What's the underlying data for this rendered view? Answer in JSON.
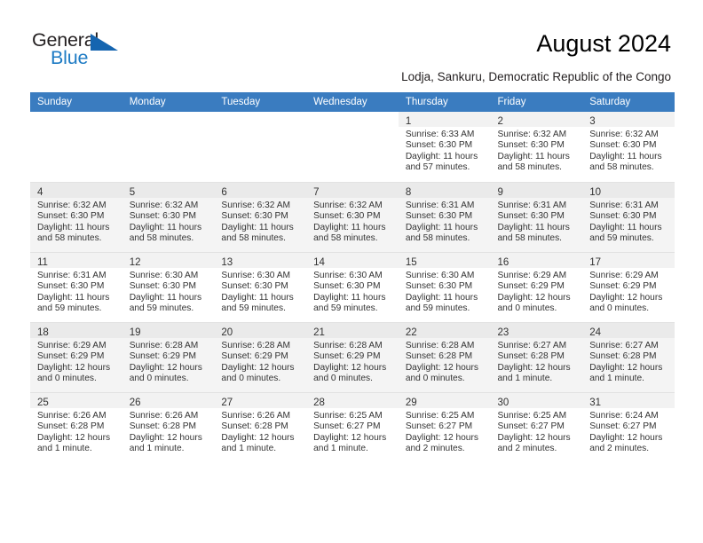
{
  "brand": {
    "name_part1": "General",
    "name_part2": "Blue",
    "triangle_color": "#1565b0",
    "blue_color": "#1e7bc4"
  },
  "header": {
    "title": "August 2024",
    "location": "Lodja, Sankuru, Democratic Republic of the Congo",
    "header_bg": "#3a7cc0"
  },
  "weekdays": [
    "Sunday",
    "Monday",
    "Tuesday",
    "Wednesday",
    "Thursday",
    "Friday",
    "Saturday"
  ],
  "weeks": [
    {
      "shaded": false,
      "days": [
        {
          "empty": true
        },
        {
          "empty": true
        },
        {
          "empty": true
        },
        {
          "empty": true
        },
        {
          "day": "1",
          "sunrise": "Sunrise: 6:33 AM",
          "sunset": "Sunset: 6:30 PM",
          "daylight1": "Daylight: 11 hours",
          "daylight2": "and 57 minutes."
        },
        {
          "day": "2",
          "sunrise": "Sunrise: 6:32 AM",
          "sunset": "Sunset: 6:30 PM",
          "daylight1": "Daylight: 11 hours",
          "daylight2": "and 58 minutes."
        },
        {
          "day": "3",
          "sunrise": "Sunrise: 6:32 AM",
          "sunset": "Sunset: 6:30 PM",
          "daylight1": "Daylight: 11 hours",
          "daylight2": "and 58 minutes."
        }
      ]
    },
    {
      "shaded": true,
      "days": [
        {
          "day": "4",
          "sunrise": "Sunrise: 6:32 AM",
          "sunset": "Sunset: 6:30 PM",
          "daylight1": "Daylight: 11 hours",
          "daylight2": "and 58 minutes."
        },
        {
          "day": "5",
          "sunrise": "Sunrise: 6:32 AM",
          "sunset": "Sunset: 6:30 PM",
          "daylight1": "Daylight: 11 hours",
          "daylight2": "and 58 minutes."
        },
        {
          "day": "6",
          "sunrise": "Sunrise: 6:32 AM",
          "sunset": "Sunset: 6:30 PM",
          "daylight1": "Daylight: 11 hours",
          "daylight2": "and 58 minutes."
        },
        {
          "day": "7",
          "sunrise": "Sunrise: 6:32 AM",
          "sunset": "Sunset: 6:30 PM",
          "daylight1": "Daylight: 11 hours",
          "daylight2": "and 58 minutes."
        },
        {
          "day": "8",
          "sunrise": "Sunrise: 6:31 AM",
          "sunset": "Sunset: 6:30 PM",
          "daylight1": "Daylight: 11 hours",
          "daylight2": "and 58 minutes."
        },
        {
          "day": "9",
          "sunrise": "Sunrise: 6:31 AM",
          "sunset": "Sunset: 6:30 PM",
          "daylight1": "Daylight: 11 hours",
          "daylight2": "and 58 minutes."
        },
        {
          "day": "10",
          "sunrise": "Sunrise: 6:31 AM",
          "sunset": "Sunset: 6:30 PM",
          "daylight1": "Daylight: 11 hours",
          "daylight2": "and 59 minutes."
        }
      ]
    },
    {
      "shaded": false,
      "days": [
        {
          "day": "11",
          "sunrise": "Sunrise: 6:31 AM",
          "sunset": "Sunset: 6:30 PM",
          "daylight1": "Daylight: 11 hours",
          "daylight2": "and 59 minutes."
        },
        {
          "day": "12",
          "sunrise": "Sunrise: 6:30 AM",
          "sunset": "Sunset: 6:30 PM",
          "daylight1": "Daylight: 11 hours",
          "daylight2": "and 59 minutes."
        },
        {
          "day": "13",
          "sunrise": "Sunrise: 6:30 AM",
          "sunset": "Sunset: 6:30 PM",
          "daylight1": "Daylight: 11 hours",
          "daylight2": "and 59 minutes."
        },
        {
          "day": "14",
          "sunrise": "Sunrise: 6:30 AM",
          "sunset": "Sunset: 6:30 PM",
          "daylight1": "Daylight: 11 hours",
          "daylight2": "and 59 minutes."
        },
        {
          "day": "15",
          "sunrise": "Sunrise: 6:30 AM",
          "sunset": "Sunset: 6:30 PM",
          "daylight1": "Daylight: 11 hours",
          "daylight2": "and 59 minutes."
        },
        {
          "day": "16",
          "sunrise": "Sunrise: 6:29 AM",
          "sunset": "Sunset: 6:29 PM",
          "daylight1": "Daylight: 12 hours",
          "daylight2": "and 0 minutes."
        },
        {
          "day": "17",
          "sunrise": "Sunrise: 6:29 AM",
          "sunset": "Sunset: 6:29 PM",
          "daylight1": "Daylight: 12 hours",
          "daylight2": "and 0 minutes."
        }
      ]
    },
    {
      "shaded": true,
      "days": [
        {
          "day": "18",
          "sunrise": "Sunrise: 6:29 AM",
          "sunset": "Sunset: 6:29 PM",
          "daylight1": "Daylight: 12 hours",
          "daylight2": "and 0 minutes."
        },
        {
          "day": "19",
          "sunrise": "Sunrise: 6:28 AM",
          "sunset": "Sunset: 6:29 PM",
          "daylight1": "Daylight: 12 hours",
          "daylight2": "and 0 minutes."
        },
        {
          "day": "20",
          "sunrise": "Sunrise: 6:28 AM",
          "sunset": "Sunset: 6:29 PM",
          "daylight1": "Daylight: 12 hours",
          "daylight2": "and 0 minutes."
        },
        {
          "day": "21",
          "sunrise": "Sunrise: 6:28 AM",
          "sunset": "Sunset: 6:29 PM",
          "daylight1": "Daylight: 12 hours",
          "daylight2": "and 0 minutes."
        },
        {
          "day": "22",
          "sunrise": "Sunrise: 6:28 AM",
          "sunset": "Sunset: 6:28 PM",
          "daylight1": "Daylight: 12 hours",
          "daylight2": "and 0 minutes."
        },
        {
          "day": "23",
          "sunrise": "Sunrise: 6:27 AM",
          "sunset": "Sunset: 6:28 PM",
          "daylight1": "Daylight: 12 hours",
          "daylight2": "and 1 minute."
        },
        {
          "day": "24",
          "sunrise": "Sunrise: 6:27 AM",
          "sunset": "Sunset: 6:28 PM",
          "daylight1": "Daylight: 12 hours",
          "daylight2": "and 1 minute."
        }
      ]
    },
    {
      "shaded": false,
      "days": [
        {
          "day": "25",
          "sunrise": "Sunrise: 6:26 AM",
          "sunset": "Sunset: 6:28 PM",
          "daylight1": "Daylight: 12 hours",
          "daylight2": "and 1 minute."
        },
        {
          "day": "26",
          "sunrise": "Sunrise: 6:26 AM",
          "sunset": "Sunset: 6:28 PM",
          "daylight1": "Daylight: 12 hours",
          "daylight2": "and 1 minute."
        },
        {
          "day": "27",
          "sunrise": "Sunrise: 6:26 AM",
          "sunset": "Sunset: 6:28 PM",
          "daylight1": "Daylight: 12 hours",
          "daylight2": "and 1 minute."
        },
        {
          "day": "28",
          "sunrise": "Sunrise: 6:25 AM",
          "sunset": "Sunset: 6:27 PM",
          "daylight1": "Daylight: 12 hours",
          "daylight2": "and 1 minute."
        },
        {
          "day": "29",
          "sunrise": "Sunrise: 6:25 AM",
          "sunset": "Sunset: 6:27 PM",
          "daylight1": "Daylight: 12 hours",
          "daylight2": "and 2 minutes."
        },
        {
          "day": "30",
          "sunrise": "Sunrise: 6:25 AM",
          "sunset": "Sunset: 6:27 PM",
          "daylight1": "Daylight: 12 hours",
          "daylight2": "and 2 minutes."
        },
        {
          "day": "31",
          "sunrise": "Sunrise: 6:24 AM",
          "sunset": "Sunset: 6:27 PM",
          "daylight1": "Daylight: 12 hours",
          "daylight2": "and 2 minutes."
        }
      ]
    }
  ]
}
